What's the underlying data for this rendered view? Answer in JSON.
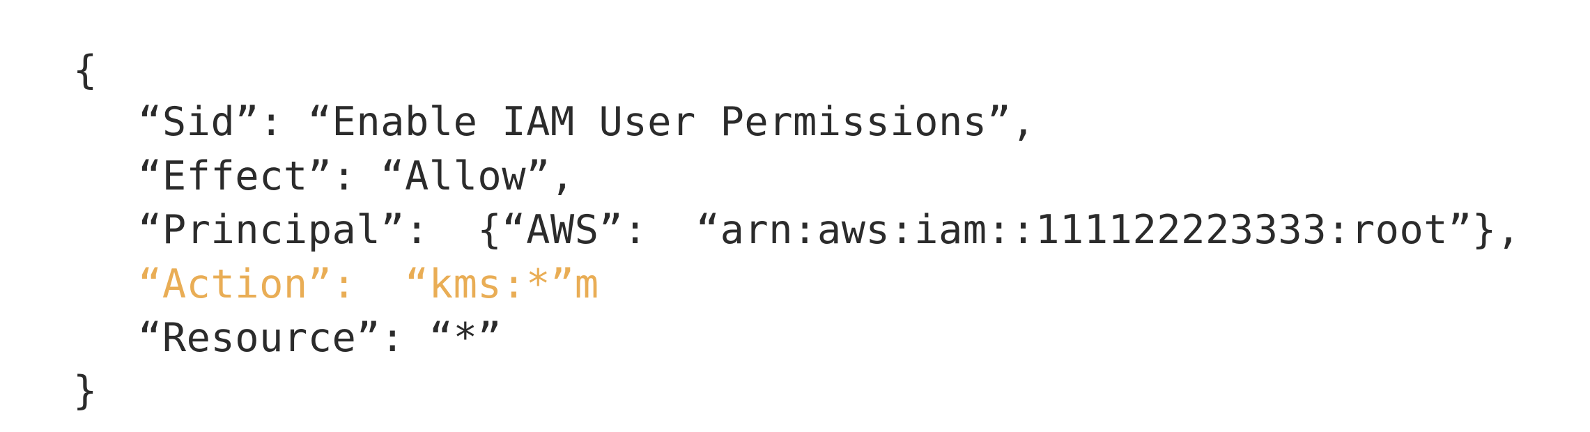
{
  "policy_statement": {
    "open_brace": "{",
    "lines": [
      "“Sid”: “Enable IAM User Permissions”,",
      "“Effect”: “Allow”,",
      "“Principal”:  {“AWS”:  “arn:aws:iam::111122223333:root”},",
      "“Action”:  “kms:*”m",
      "“Resource”: “*”"
    ],
    "close_brace": "}"
  },
  "colors": {
    "background": "#ffffff",
    "text": "#2b2b2b",
    "highlighted_line": "#e9ad55"
  }
}
